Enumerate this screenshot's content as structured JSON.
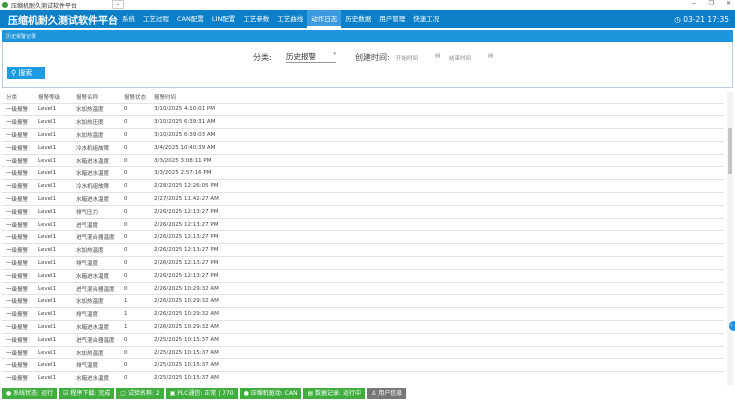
{
  "window": {
    "title": "压缩机耐久测试软件平台",
    "controls": [
      "−",
      "❐",
      "✕"
    ]
  },
  "nav": {
    "brand": "压缩机耐久测试软件平台",
    "items": [
      "系统",
      "工艺过程",
      "CAN配置",
      "LIN配置",
      "工艺参数",
      "工艺曲线",
      "动作日志",
      "历史数据",
      "用户管理",
      "快速工况"
    ],
    "active": 6,
    "clock": "03-21 17:35"
  },
  "sub": {
    "text": "历史报警记录"
  },
  "filter": {
    "category_label": "分类:",
    "category_value": "历史报警",
    "time_label": "创建时间:",
    "start_placeholder": "开始时间",
    "end_placeholder": "结束时间",
    "search_label": "搜索"
  },
  "table": {
    "headers": [
      "分类",
      "报警等级",
      "报警名称",
      "报警状态",
      "报警时间"
    ],
    "rows": [
      [
        "一级报警",
        "Level1",
        "水加热温度",
        "0",
        "3/10/2025 4:10:01 PM"
      ],
      [
        "一级报警",
        "Level1",
        "水加热压度",
        "0",
        "3/10/2025 6:39:31 AM"
      ],
      [
        "一级报警",
        "Level1",
        "水加热温度",
        "0",
        "3/10/2025 6:39:03 AM"
      ],
      [
        "一级报警",
        "Level1",
        "冷水机组故障",
        "0",
        "3/4/2025 10:40:39 AM"
      ],
      [
        "一级报警",
        "Level1",
        "水箱进水温度",
        "0",
        "3/3/2025 3:08:11 PM"
      ],
      [
        "一级报警",
        "Level1",
        "水箱进水温度",
        "0",
        "3/3/2025 2:57:16 PM"
      ],
      [
        "一级报警",
        "Level1",
        "冷水机组故障",
        "0",
        "2/28/2025 12:26:05 PM"
      ],
      [
        "一级报警",
        "Level1",
        "水箱进水温度",
        "0",
        "2/27/2025 11:42:27 AM"
      ],
      [
        "一级报警",
        "Level1",
        "排气压力",
        "0",
        "2/26/2025 12:13:27 PM"
      ],
      [
        "一级报警",
        "Level1",
        "进气温度",
        "0",
        "2/26/2025 12:13:27 PM"
      ],
      [
        "一级报警",
        "Level1",
        "进气混合器温度",
        "0",
        "2/26/2025 12:13:27 PM"
      ],
      [
        "一级报警",
        "Level1",
        "水加热温度",
        "0",
        "2/26/2025 12:13:27 PM"
      ],
      [
        "一级报警",
        "Level1",
        "排气温度",
        "0",
        "2/26/2025 12:13:27 PM"
      ],
      [
        "一级报警",
        "Level1",
        "水箱进水温度",
        "0",
        "2/26/2025 12:13:27 PM"
      ],
      [
        "一级报警",
        "Level1",
        "进气混合器温度",
        "0",
        "2/26/2025 10:29:32 AM"
      ],
      [
        "一级报警",
        "Level1",
        "水加热温度",
        "1",
        "2/26/2025 10:29:32 AM"
      ],
      [
        "一级报警",
        "Level1",
        "排气温度",
        "1",
        "2/26/2025 10:29:32 AM"
      ],
      [
        "一级报警",
        "Level1",
        "水箱进水温度",
        "1",
        "2/26/2025 10:29:32 AM"
      ],
      [
        "一级报警",
        "Level1",
        "进气混合器温度",
        "0",
        "2/25/2025 10:15:37 AM"
      ],
      [
        "一级报警",
        "Level1",
        "水加热温度",
        "0",
        "2/25/2025 10:15:37 AM"
      ],
      [
        "一级报警",
        "Level1",
        "排气温度",
        "0",
        "2/25/2025 10:15:37 AM"
      ],
      [
        "一级报警",
        "Level1",
        "水箱进水温度",
        "0",
        "2/25/2025 10:15:37 AM"
      ]
    ]
  },
  "status": [
    "● 系统状态: 运行",
    "☑ 程序下载: 完成",
    "▢ 试验名称:                    2",
    "▣ PLC通信: 正常 | 770",
    "● 压缩机驱动: CAN",
    "▤ 数据记录: 运行中",
    "♙ 用户信息"
  ],
  "colors": {
    "nav": "#0b7fc7",
    "status_ok": "#3fae3f"
  }
}
